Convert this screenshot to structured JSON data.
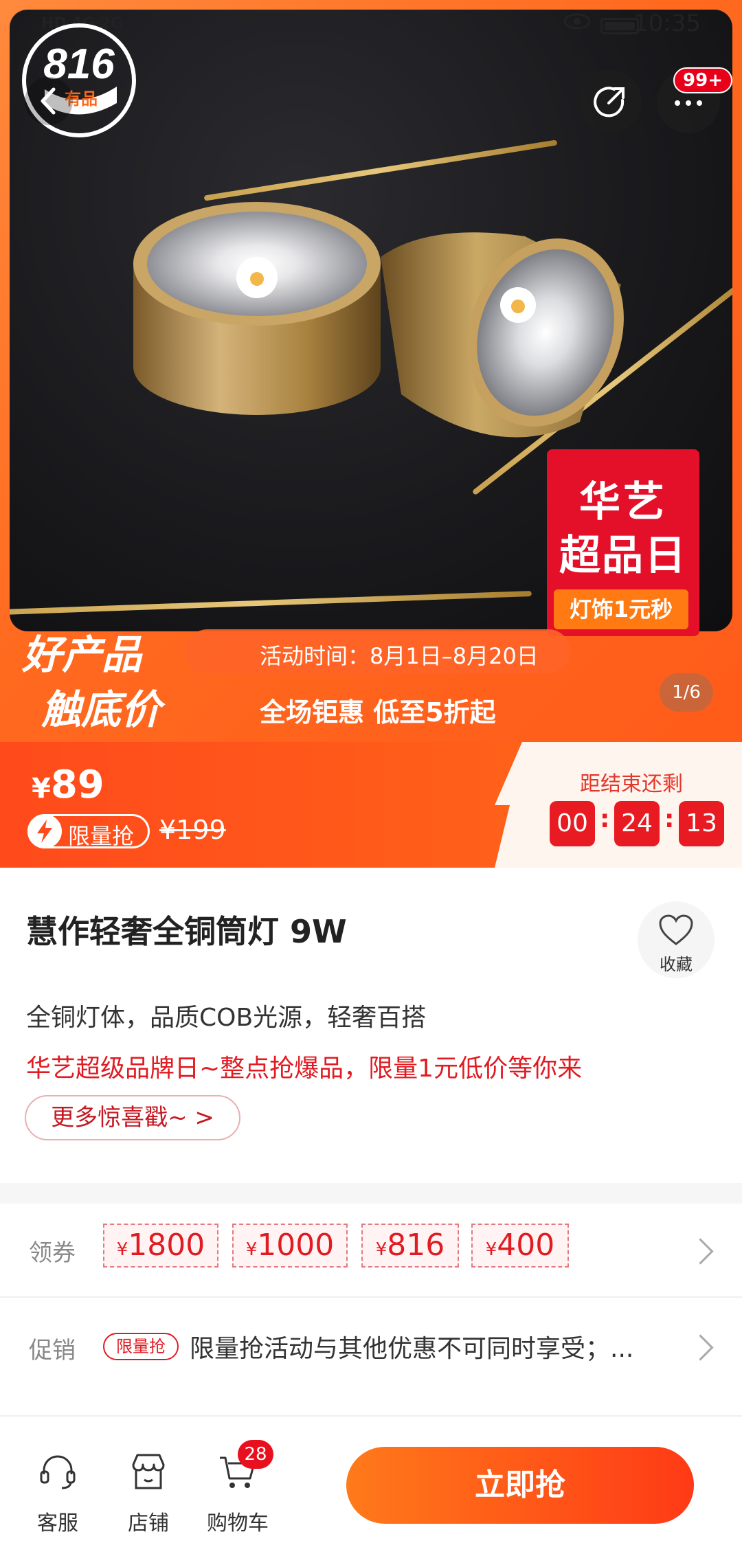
{
  "status_bar": {
    "network": "HD 4G 2G",
    "time": "10:35"
  },
  "logo": {
    "number": "816",
    "text": "有品"
  },
  "header": {
    "more_badge": "99+"
  },
  "promo_card": {
    "line1": "华艺",
    "line2": "超品日",
    "line3": "灯饰1元秒"
  },
  "banner": {
    "slogan_line1": "好产品",
    "slogan_line2": "触底价",
    "activity_time": "活动时间：8月1日–8月20日",
    "deal_text": "全场钜惠 低至5折起",
    "image_counter": "1/6"
  },
  "price": {
    "currency": "¥",
    "current": "89",
    "flash_label": "限量抢",
    "original": "¥199",
    "countdown_label": "距结束还剩",
    "countdown": [
      "00",
      "24",
      "13"
    ]
  },
  "product": {
    "title": "慧作轻奢全铜筒灯 9W",
    "favorite_label": "收藏",
    "subtitle": "全铜灯体，品质COB光源，轻奢百搭",
    "promo_line": "华艺超级品牌日~整点抢爆品，限量1元低价等你来",
    "more_label": "更多惊喜戳~ >"
  },
  "coupons": {
    "label": "领券",
    "items": [
      {
        "symbol": "¥",
        "amount": "1800"
      },
      {
        "symbol": "¥",
        "amount": "1000"
      },
      {
        "symbol": "¥",
        "amount": "816"
      },
      {
        "symbol": "¥",
        "amount": "400"
      }
    ]
  },
  "promotion": {
    "label": "促销",
    "tag": "限量抢",
    "text": "限量抢活动与其他优惠不可同时享受；..."
  },
  "bottom_nav": {
    "service": "客服",
    "store": "店铺",
    "cart": "购物车",
    "cart_count": "28",
    "buy": "立即抢"
  }
}
